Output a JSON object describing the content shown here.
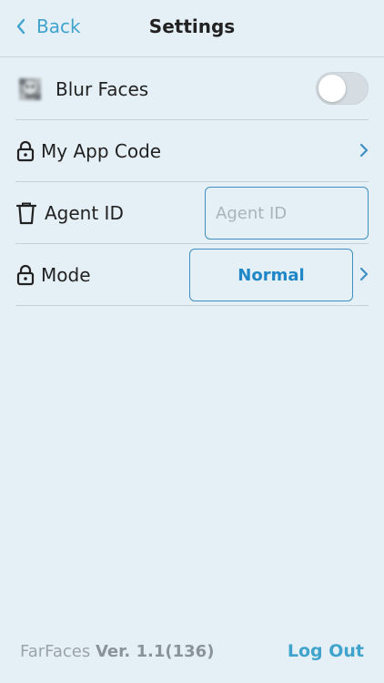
{
  "header": {
    "back_label": "Back",
    "title": "Settings"
  },
  "settings": {
    "blur_faces": {
      "label": "Blur Faces",
      "enabled": false
    },
    "app_code": {
      "label": "My App Code"
    },
    "agent_id": {
      "label": "Agent ID",
      "placeholder": "Agent ID",
      "value": ""
    },
    "mode": {
      "label": "Mode",
      "value": "Normal"
    }
  },
  "footer": {
    "app_name": "FarFaces",
    "version_label": "Ver. 1.1(136)",
    "logout_label": "Log Out"
  },
  "colors": {
    "accent": "#3fa3cc",
    "button_text": "#1f86c7",
    "background": "#e5f0f6"
  },
  "icons": {
    "back": "chevron-left-icon",
    "blur": "blurred-face-icon",
    "lock": "lock-icon",
    "trash": "trash-icon",
    "chevron": "chevron-right-icon"
  }
}
